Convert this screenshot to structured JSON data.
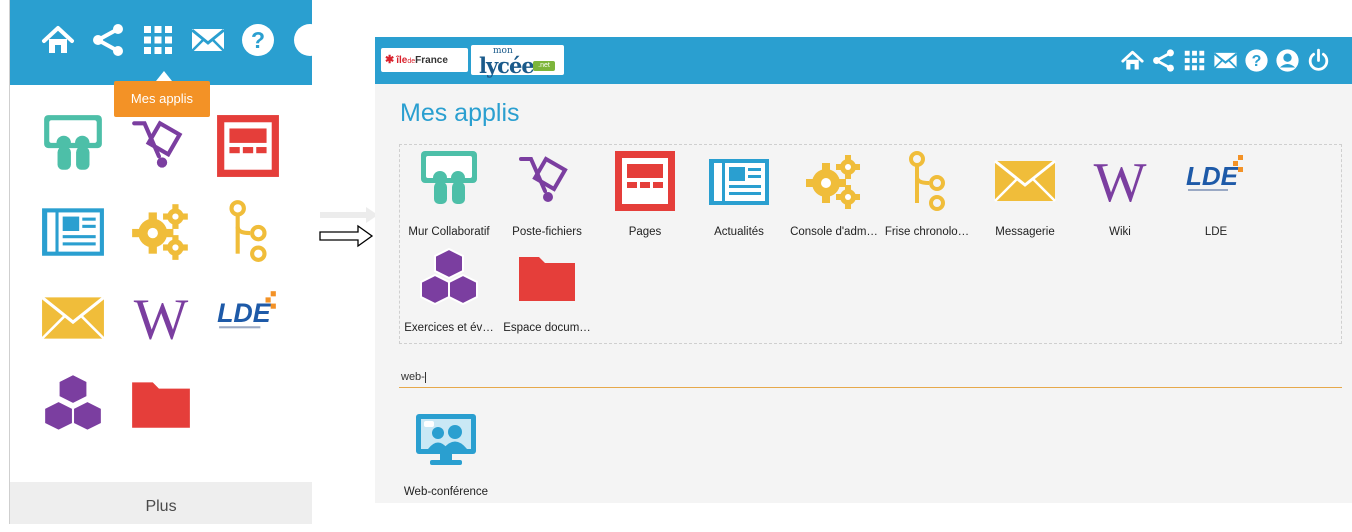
{
  "left_panel": {
    "tooltip": "Mes applis",
    "more_label": "Plus",
    "top_icons": [
      "home-icon",
      "share-icon",
      "apps-grid-icon",
      "mail-icon",
      "help-icon",
      "user-icon"
    ]
  },
  "right_panel": {
    "logos": {
      "iledefrance_star": "✱",
      "iledefrance_ile": "île",
      "iledefrance_de": "de",
      "iledefrance_france": "France",
      "lycee_mon": "mon",
      "lycee_name": "lycée",
      "lycee_net": ".net"
    },
    "top_icons": [
      "home-icon",
      "share-icon",
      "apps-grid-icon",
      "mail-icon",
      "help-icon",
      "user-icon",
      "power-icon"
    ],
    "title": "Mes applis",
    "apps": [
      {
        "label": "Mur Collaboratif",
        "icon": "collaborative-wall-icon"
      },
      {
        "label": "Poste-fichiers",
        "icon": "file-cart-icon"
      },
      {
        "label": "Pages",
        "icon": "pages-icon"
      },
      {
        "label": "Actualités",
        "icon": "news-icon"
      },
      {
        "label": "Console d'adm…",
        "icon": "admin-gears-icon"
      },
      {
        "label": "Frise chronolo…",
        "icon": "timeline-icon"
      },
      {
        "label": "Messagerie",
        "icon": "messaging-icon"
      },
      {
        "label": "Wiki",
        "icon": "wiki-icon"
      },
      {
        "label": "LDE",
        "icon": "lde-icon"
      },
      {
        "label": "Exercices et év…",
        "icon": "exercises-cubes-icon"
      },
      {
        "label": "Espace docum…",
        "icon": "folder-icon"
      }
    ],
    "search_value": "web-",
    "web_app": {
      "label": "Web-conférence",
      "icon": "web-conference-icon"
    }
  },
  "colors": {
    "topbar": "#2a9fd0",
    "tooltip": "#f39226",
    "collab_teal": "#4dbfa8",
    "purple": "#7b3ea0",
    "red": "#e53e3a",
    "blue": "#2a9fd0",
    "yellow": "#f0bd3a",
    "lde_blue": "#1e5aa8",
    "lde_orange": "#f39226"
  }
}
